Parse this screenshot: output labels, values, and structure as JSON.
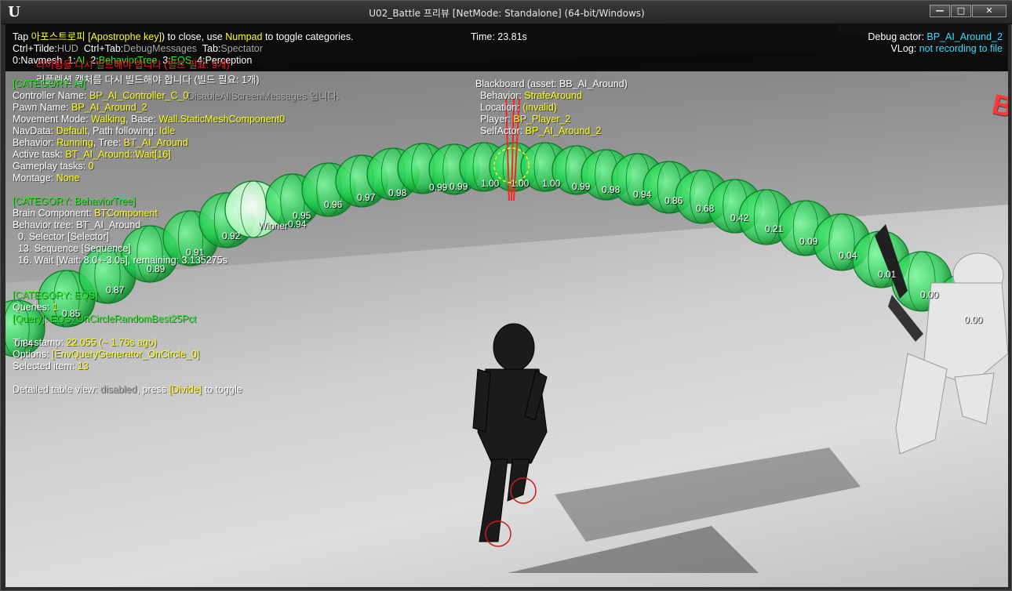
{
  "window": {
    "title": "U02_Battle 프리뷰 [NetMode: Standalone]  (64-bit/Windows)",
    "logo": "U",
    "buttons": {
      "minimize": "—",
      "maximize": "□",
      "close": "✕"
    }
  },
  "hud_top": {
    "line1": {
      "a": "Tap ",
      "b": "아포스트로피 [Apostrophe key]",
      "c": ") to close, use ",
      "d": "Numpad",
      "e": " to toggle categories."
    },
    "line2": {
      "a": "Ctrl+Tilde:",
      "b": "HUD",
      "c": "  Ctrl+Tab:",
      "d": "DebugMessages",
      "e": "  Tab:",
      "f": "Spectator"
    },
    "line3": {
      "a": "0:Navmesh  1:",
      "b": "AI",
      "c": "  2:",
      "d": "BehaviorTree",
      "e": "  3:",
      "f": "EQS",
      "g": "  4:Perception"
    },
    "time": "Time: 23.81s",
    "debug_actor_label": "Debug actor: ",
    "debug_actor_value": "BP_AI_Around_2",
    "vlog_label": "VLog: ",
    "vlog_value": "not recording to file"
  },
  "warnings": {
    "lighting": "라이팅을 다시 빌드해야 합니다 (빌드 필요: 9개)",
    "reflection": "리플렉션 캡처를 다시 빌드해야 합니다 (빌드 필요: 1개)",
    "disable_msg": "DisableAllScreenMessages 입니다."
  },
  "ai_panel": {
    "category": "[CATEGORY: AI]",
    "controller_label": "Controller Name: ",
    "controller_value": "BP_AI_Controller_C_0",
    "pawn_label": "Pawn Name: ",
    "pawn_value": "BP_AI_Around_2",
    "move_label": "Movement Mode: ",
    "move_value": "Walking",
    "base_label": ", Base: ",
    "base_value": "Wall.StaticMeshComponent0",
    "nav_label": "NavData: ",
    "nav_value": "Default",
    "path_label": ", Path following: ",
    "path_value": "Idle",
    "behavior_label": "Behavior: ",
    "behavior_value": "Running",
    "tree_label": ", Tree: ",
    "tree_value": "BT_AI_Around",
    "task_label": "Active task: ",
    "task_value": "BT_AI_Around::Wait[16]",
    "gp_label": "Gameplay tasks: ",
    "gp_value": "0",
    "montage_label": "Montage: ",
    "montage_value": "None"
  },
  "bt_panel": {
    "category": "[CATEGORY: BehaviorTree]",
    "brain_label": "Brain Component: ",
    "brain_value": "BTComponent",
    "tree_line": "Behavior tree: BT_AI_Around",
    "node0": "  0. Selector [Selector]",
    "node13": "  13. Sequence [Sequence]",
    "node16": "  16. Wait [Wait: 8.0+-3.0s], remaining: 3.135275s"
  },
  "eqs_panel": {
    "category": "[CATEGORY: EQS]",
    "queries_label": "Queries: ",
    "queries_value": "1",
    "query_name": "[Query]: EQS_OnCircleRandomBest25Pct",
    "timestamp_label": "Timestamp: ",
    "timestamp_value": "22.055 (~ 1.76s ago)",
    "options_label": "Options: ",
    "options_value": "[EnvQueryGenerator_OnCircle_0]",
    "selected_label": "Selected item: ",
    "selected_value": "13",
    "detail_a": "Detailed table view: ",
    "detail_b": "disabled",
    "detail_c": ", press ",
    "detail_d": "[Divide]",
    "detail_e": " to toggle"
  },
  "blackboard": {
    "header": "Blackboard (asset: BB_AI_Around)",
    "behavior_label": "Behavior: ",
    "behavior_value": "StrafeAround",
    "location_label": "Location: ",
    "location_value": "(invalid)",
    "player_label": "Player: ",
    "player_value": "BP_Player_2",
    "self_label": "SelfActor: ",
    "self_value": "BP_AI_Around_2"
  },
  "scores": [
    "0.84",
    "0.85",
    "0.87",
    "0.89",
    "0.91",
    "0.92",
    "0.94",
    "0.95",
    "0.96",
    "0.97",
    "0.98",
    "0.99",
    "0.99",
    "1.00",
    "1.00",
    "1.00",
    "0.99",
    "0.98",
    "0.94",
    "0.86",
    "0.68",
    "0.42",
    "0.21",
    "0.09",
    "0.04",
    "0.01",
    "0.00",
    "0.00"
  ],
  "winner_label": "Winner",
  "floating_text": "B",
  "colors": {
    "yellow": "#ffff1a",
    "cyan": "#38e0ff",
    "green": "#22ee22",
    "red": "#ff2020"
  }
}
